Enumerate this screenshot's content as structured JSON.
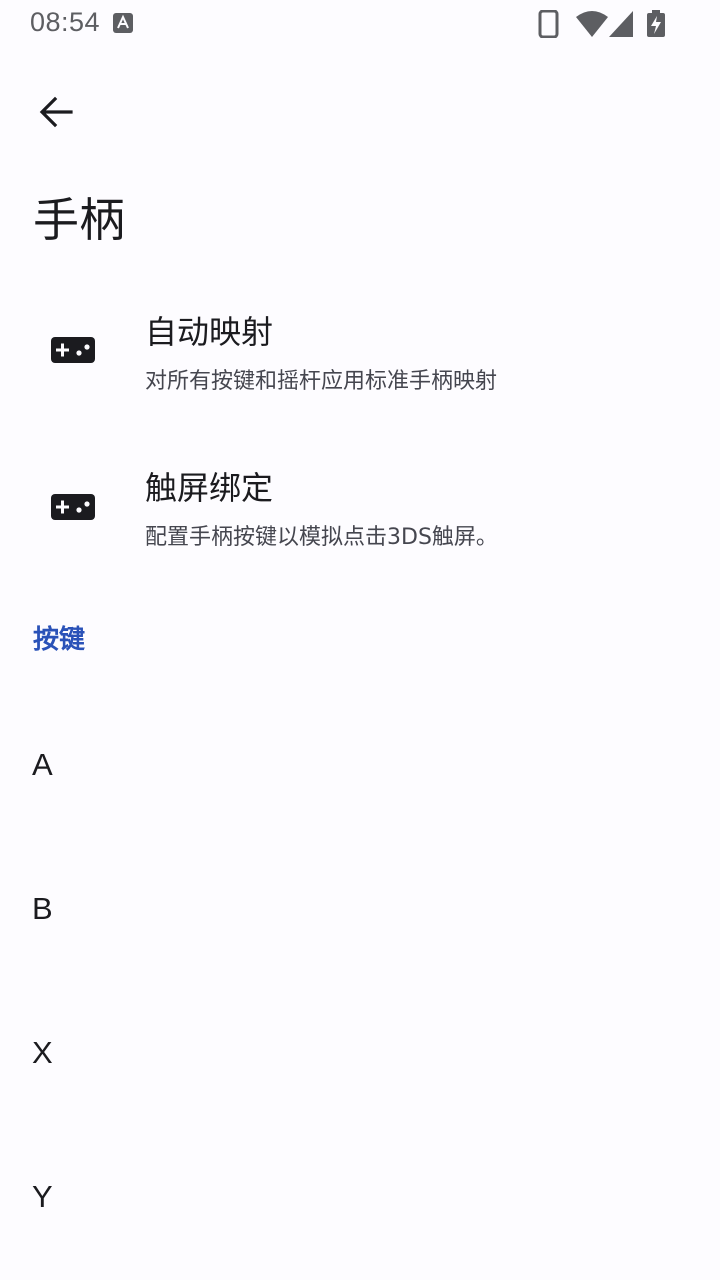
{
  "status_bar": {
    "time": "08:54",
    "icons": [
      "font-a-icon",
      "phone-vibrate-icon",
      "wifi-icon",
      "cellular-signal-icon",
      "battery-charging-icon"
    ]
  },
  "app_bar": {
    "back_icon": "arrow-back-icon"
  },
  "page": {
    "title": "手柄"
  },
  "settings": [
    {
      "icon": "gamepad-icon",
      "title": "自动映射",
      "summary": "对所有按键和摇杆应用标准手柄映射"
    },
    {
      "icon": "gamepad-icon",
      "title": "触屏绑定",
      "summary": "配置手柄按键以模拟点击3DS触屏。"
    }
  ],
  "buttons_section": {
    "header": "按键",
    "items": [
      {
        "label": "A"
      },
      {
        "label": "B"
      },
      {
        "label": "X"
      },
      {
        "label": "Y"
      }
    ]
  },
  "colors": {
    "background": "#fdfcff",
    "accent": "#2a52b8",
    "text_primary": "#1b1b1f",
    "text_secondary": "#45464f",
    "status_icons": "#5d5e62"
  }
}
